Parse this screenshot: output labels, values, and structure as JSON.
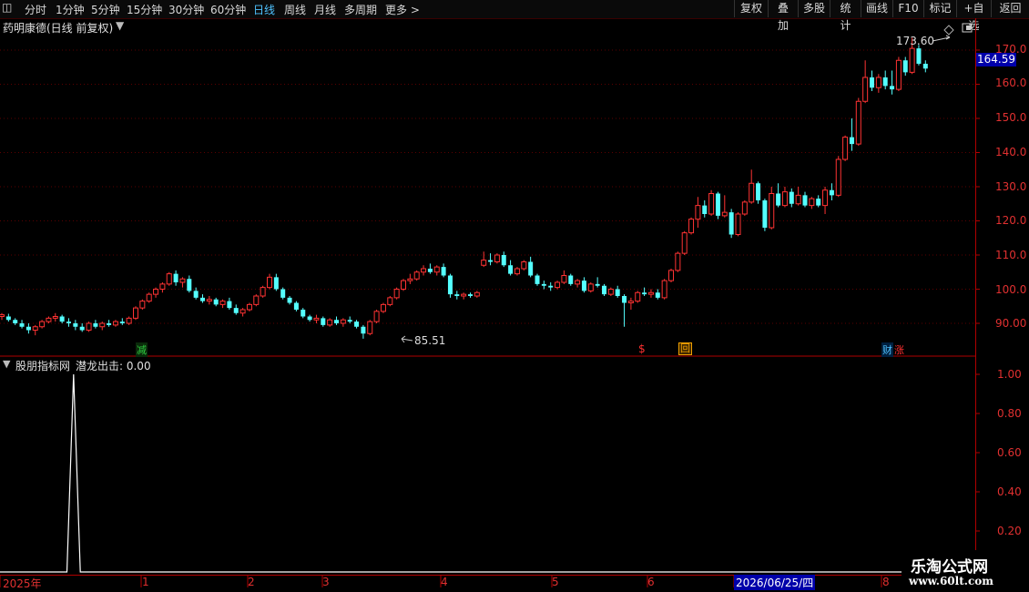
{
  "toolbar": {
    "tabs": [
      {
        "label": "分时"
      },
      {
        "label": "1分钟"
      },
      {
        "label": "5分钟"
      },
      {
        "label": "15分钟"
      },
      {
        "label": "30分钟"
      },
      {
        "label": "60分钟"
      },
      {
        "label": "日线",
        "active": true
      },
      {
        "label": "周线"
      },
      {
        "label": "月线"
      },
      {
        "label": "多周期"
      },
      {
        "label": "更多 >"
      }
    ],
    "right_buttons": [
      "复权",
      "叠加",
      "多股",
      "统计",
      "画线",
      "F10",
      "标记",
      "+自选",
      "返回"
    ]
  },
  "main_chart": {
    "title": "药明康德(日线 前复权)",
    "last_price_label": "164.59",
    "high_label": "173.60",
    "low_label": "85.51",
    "y_ticks": [
      "170.0",
      "160.0",
      "150.0",
      "140.0",
      "130.0",
      "120.0",
      "110.0",
      "100.0",
      "90.00"
    ],
    "markers": [
      {
        "text": "减",
        "color": "#2ecc40"
      },
      {
        "text": "$",
        "color": "#ff3030"
      },
      {
        "text": "回",
        "color": "#f0a000"
      },
      {
        "text": "财",
        "color": "#4fc3ff"
      },
      {
        "text": "涨",
        "color": "#ff3030"
      }
    ],
    "colors": {
      "up": "#ff3333",
      "down": "#54ffff",
      "grid": "#5a0000",
      "axis": "#b00000",
      "label_box": "#0000aa"
    }
  },
  "indicator": {
    "title": "股朋指标网",
    "series_label": "潜龙出击: 0.00",
    "y_ticks": [
      "1.00",
      "0.80",
      "0.60",
      "0.40",
      "0.20"
    ]
  },
  "x_axis": {
    "labels": [
      "2025年",
      "1",
      "2",
      "3",
      "4",
      "5",
      "6",
      "2026/06/25/四",
      "8"
    ]
  },
  "watermark": {
    "line1": "乐淘公式网",
    "line2": "www.60lt.com"
  },
  "chart_data": [
    {
      "type": "candlestick",
      "title": "药明康德(日线 前复权)",
      "ylim": [
        84,
        176
      ],
      "annotations": {
        "high": 173.6,
        "low": 85.51,
        "last": 164.59
      },
      "candles": [
        [
          92.0,
          93.0,
          91.0,
          92.5
        ],
        [
          92.0,
          92.8,
          90.5,
          91.0
        ],
        [
          91.0,
          91.5,
          89.5,
          90.0
        ],
        [
          90.0,
          91.0,
          88.5,
          89.0
        ],
        [
          89.0,
          90.0,
          87.0,
          88.0
        ],
        [
          88.0,
          89.5,
          86.5,
          89.0
        ],
        [
          89.0,
          91.0,
          88.5,
          90.5
        ],
        [
          90.5,
          92.0,
          90.0,
          91.5
        ],
        [
          91.5,
          93.0,
          90.5,
          92.0
        ],
        [
          92.0,
          92.5,
          90.0,
          90.5
        ],
        [
          90.5,
          91.5,
          89.0,
          90.0
        ],
        [
          90.0,
          91.0,
          88.0,
          89.0
        ],
        [
          89.0,
          90.0,
          87.5,
          88.0
        ],
        [
          88.0,
          90.5,
          87.5,
          90.0
        ],
        [
          90.0,
          91.0,
          88.5,
          89.0
        ],
        [
          89.0,
          90.5,
          88.0,
          90.0
        ],
        [
          90.0,
          91.0,
          89.0,
          89.5
        ],
        [
          89.5,
          91.0,
          89.0,
          90.5
        ],
        [
          90.5,
          91.5,
          89.5,
          90.0
        ],
        [
          90.0,
          92.0,
          89.5,
          91.5
        ],
        [
          91.5,
          95.0,
          91.0,
          94.5
        ],
        [
          94.5,
          97.0,
          94.0,
          96.5
        ],
        [
          96.5,
          99.0,
          96.0,
          98.5
        ],
        [
          98.5,
          100.5,
          97.5,
          100.0
        ],
        [
          100.0,
          102.0,
          99.0,
          101.5
        ],
        [
          101.5,
          105.0,
          101.0,
          104.5
        ],
        [
          104.5,
          105.5,
          101.0,
          102.0
        ],
        [
          102.0,
          103.5,
          100.5,
          103.0
        ],
        [
          103.0,
          104.0,
          99.0,
          99.5
        ],
        [
          99.5,
          100.5,
          97.0,
          97.5
        ],
        [
          97.5,
          98.5,
          96.0,
          96.5
        ],
        [
          96.5,
          98.0,
          95.5,
          97.0
        ],
        [
          97.0,
          97.5,
          95.0,
          95.5
        ],
        [
          95.5,
          97.0,
          94.5,
          96.5
        ],
        [
          96.5,
          97.5,
          94.0,
          94.5
        ],
        [
          94.5,
          95.5,
          92.5,
          93.0
        ],
        [
          93.0,
          94.5,
          92.0,
          94.0
        ],
        [
          94.0,
          96.0,
          93.5,
          95.5
        ],
        [
          95.5,
          98.5,
          95.0,
          98.0
        ],
        [
          98.0,
          101.0,
          97.5,
          100.5
        ],
        [
          100.5,
          104.5,
          100.0,
          103.5
        ],
        [
          103.5,
          104.5,
          99.5,
          100.0
        ],
        [
          100.0,
          100.5,
          97.0,
          97.5
        ],
        [
          97.5,
          98.0,
          95.5,
          96.0
        ],
        [
          96.0,
          96.5,
          93.5,
          94.0
        ],
        [
          94.0,
          94.5,
          91.5,
          92.0
        ],
        [
          92.0,
          92.5,
          90.5,
          91.0
        ],
        [
          91.0,
          92.5,
          90.0,
          91.5
        ],
        [
          91.5,
          92.0,
          89.0,
          89.5
        ],
        [
          89.5,
          91.5,
          89.0,
          91.0
        ],
        [
          91.0,
          92.0,
          89.5,
          90.0
        ],
        [
          90.0,
          91.5,
          89.0,
          91.0
        ],
        [
          91.0,
          92.0,
          90.0,
          90.5
        ],
        [
          90.5,
          91.0,
          88.5,
          89.0
        ],
        [
          89.0,
          89.5,
          85.5,
          87.0
        ],
        [
          87.0,
          91.0,
          86.5,
          90.5
        ],
        [
          90.5,
          94.0,
          90.0,
          93.5
        ],
        [
          93.5,
          96.0,
          93.0,
          95.5
        ],
        [
          95.5,
          98.0,
          95.0,
          97.5
        ],
        [
          97.5,
          100.5,
          97.0,
          100.0
        ],
        [
          100.0,
          103.0,
          99.5,
          102.5
        ],
        [
          102.5,
          104.5,
          101.5,
          103.0
        ],
        [
          103.0,
          105.5,
          102.5,
          105.0
        ],
        [
          105.0,
          107.0,
          104.0,
          106.0
        ],
        [
          106.0,
          107.5,
          104.5,
          105.0
        ],
        [
          105.0,
          107.0,
          104.0,
          106.5
        ],
        [
          106.5,
          107.5,
          103.5,
          104.0
        ],
        [
          104.0,
          104.5,
          97.5,
          98.5
        ],
        [
          98.5,
          99.5,
          97.0,
          98.0
        ],
        [
          98.0,
          99.0,
          97.0,
          98.5
        ],
        [
          98.5,
          99.0,
          97.5,
          98.0
        ],
        [
          98.0,
          99.5,
          97.5,
          99.0
        ],
        [
          107.0,
          111.0,
          106.5,
          108.5
        ],
        [
          108.5,
          110.5,
          107.0,
          108.0
        ],
        [
          108.0,
          110.5,
          107.5,
          110.0
        ],
        [
          110.0,
          111.0,
          106.5,
          107.0
        ],
        [
          107.0,
          108.5,
          104.0,
          104.5
        ],
        [
          104.5,
          106.5,
          104.0,
          106.0
        ],
        [
          106.0,
          108.5,
          105.5,
          108.0
        ],
        [
          108.0,
          109.5,
          103.5,
          104.0
        ],
        [
          104.0,
          104.5,
          101.0,
          101.5
        ],
        [
          101.5,
          102.5,
          100.0,
          101.0
        ],
        [
          101.0,
          102.0,
          99.5,
          100.5
        ],
        [
          100.5,
          102.5,
          100.0,
          102.0
        ],
        [
          102.0,
          105.5,
          101.5,
          104.0
        ],
        [
          104.0,
          104.5,
          101.0,
          101.5
        ],
        [
          101.5,
          103.0,
          100.5,
          102.5
        ],
        [
          102.5,
          103.5,
          99.0,
          99.5
        ],
        [
          99.5,
          102.0,
          99.0,
          101.5
        ],
        [
          101.5,
          103.5,
          100.5,
          101.0
        ],
        [
          101.0,
          101.5,
          98.0,
          98.5
        ],
        [
          98.5,
          100.5,
          98.0,
          100.0
        ],
        [
          100.0,
          101.0,
          97.5,
          98.0
        ],
        [
          98.0,
          98.5,
          89.0,
          96.0
        ],
        [
          96.0,
          97.5,
          94.0,
          96.5
        ],
        [
          96.5,
          99.5,
          96.0,
          99.0
        ],
        [
          99.0,
          100.5,
          98.0,
          98.5
        ],
        [
          98.5,
          100.0,
          97.5,
          99.0
        ],
        [
          99.0,
          100.0,
          97.0,
          97.5
        ],
        [
          97.5,
          103.0,
          97.0,
          102.5
        ],
        [
          102.5,
          106.0,
          102.0,
          105.5
        ],
        [
          105.5,
          111.0,
          105.0,
          110.5
        ],
        [
          110.5,
          117.0,
          110.0,
          116.5
        ],
        [
          116.5,
          121.0,
          116.0,
          120.5
        ],
        [
          120.5,
          127.0,
          118.0,
          124.5
        ],
        [
          124.5,
          126.0,
          121.0,
          122.0
        ],
        [
          122.0,
          129.0,
          121.5,
          128.0
        ],
        [
          128.0,
          128.5,
          120.5,
          121.5
        ],
        [
          121.5,
          127.5,
          121.0,
          122.5
        ],
        [
          122.5,
          123.5,
          115.0,
          116.0
        ],
        [
          116.0,
          122.5,
          115.5,
          122.0
        ],
        [
          122.0,
          126.0,
          121.5,
          125.5
        ],
        [
          125.5,
          135.0,
          125.0,
          131.0
        ],
        [
          131.0,
          131.5,
          125.0,
          126.0
        ],
        [
          126.0,
          126.5,
          117.0,
          118.0
        ],
        [
          118.0,
          130.0,
          117.5,
          128.0
        ],
        [
          128.0,
          131.0,
          124.0,
          124.5
        ],
        [
          124.5,
          130.0,
          124.0,
          128.5
        ],
        [
          128.5,
          129.5,
          124.0,
          125.0
        ],
        [
          125.0,
          130.0,
          124.5,
          127.5
        ],
        [
          127.5,
          128.5,
          124.0,
          124.5
        ],
        [
          124.5,
          127.0,
          123.5,
          126.5
        ],
        [
          126.5,
          127.5,
          124.0,
          124.5
        ],
        [
          124.5,
          130.0,
          122.0,
          129.0
        ],
        [
          129.0,
          131.0,
          126.0,
          127.5
        ],
        [
          127.5,
          139.0,
          127.0,
          138.0
        ],
        [
          138.0,
          145.0,
          137.5,
          144.5
        ],
        [
          144.5,
          150.0,
          140.5,
          142.5
        ],
        [
          142.5,
          156.0,
          142.0,
          155.0
        ],
        [
          155.0,
          167.0,
          154.5,
          162.0
        ],
        [
          162.0,
          164.0,
          158.0,
          159.0
        ],
        [
          159.0,
          163.0,
          157.5,
          162.0
        ],
        [
          162.0,
          164.0,
          158.5,
          159.5
        ],
        [
          159.5,
          164.0,
          157.0,
          158.5
        ],
        [
          158.5,
          168.0,
          158.0,
          167.0
        ],
        [
          167.0,
          168.0,
          162.5,
          163.5
        ],
        [
          163.5,
          173.6,
          163.0,
          170.5
        ],
        [
          170.5,
          171.5,
          165.5,
          166.0
        ],
        [
          166.0,
          167.0,
          163.5,
          164.59
        ]
      ]
    },
    {
      "type": "line",
      "title": "潜龙出击",
      "ylim": [
        0,
        1.1
      ],
      "spike_index": 11,
      "values_note_count": 143
    }
  ]
}
